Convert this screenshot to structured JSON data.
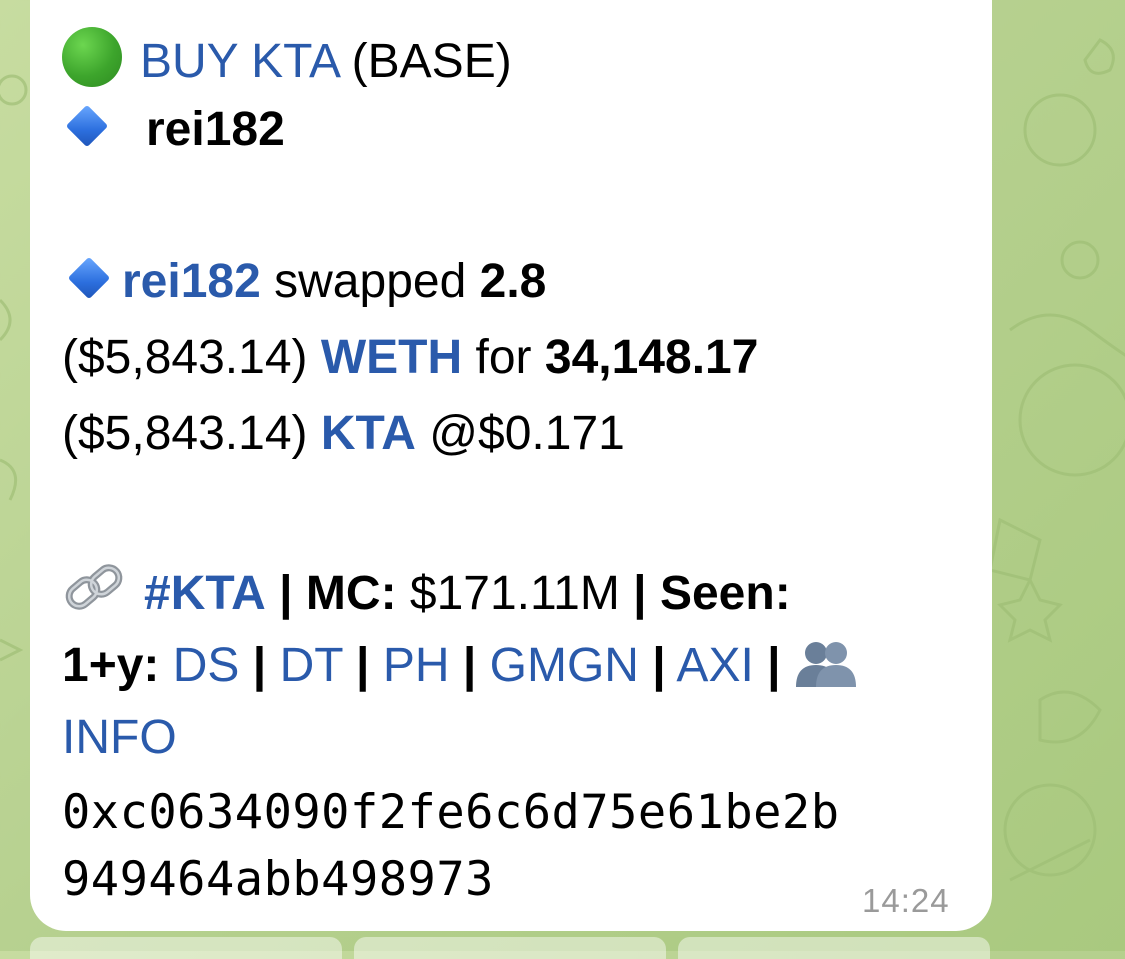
{
  "message": {
    "title": {
      "icon": "green-circle-icon",
      "action": "BUY KTA",
      "network": "(BASE)"
    },
    "wallet_name": "rei182",
    "swap": {
      "user": "rei182",
      "verb": "swapped",
      "amount_in": "2.8",
      "value_in": "($5,843.14)",
      "token_in": "WETH",
      "for_word": "for",
      "amount_out": "34,148.17",
      "value_out": "($5,843.14)",
      "token_out": "KTA",
      "price": "@$0.171"
    },
    "stats": {
      "icon": "link-icon",
      "hashtag": "#KTA",
      "separator": "|",
      "mc_label": "MC",
      "colon": ":",
      "mc_value": "$171.11M",
      "seen_label": "Seen",
      "seen_value": "1+y",
      "links": [
        "DS",
        "DT",
        "PH",
        "GMGN",
        "AXI"
      ],
      "people_icon": "people-icon",
      "info_label": "INFO"
    },
    "contract": {
      "line1": "0xc0634090f2fe6c6d75e61be2b",
      "line2": "949464abb498973"
    },
    "timestamp": "14:24"
  },
  "colors": {
    "link_blue": "#2a5aab",
    "text": "#000000",
    "timestamp": "#9a9a9a",
    "bubble": "#ffffff",
    "wallpaper": "#b7d190"
  }
}
